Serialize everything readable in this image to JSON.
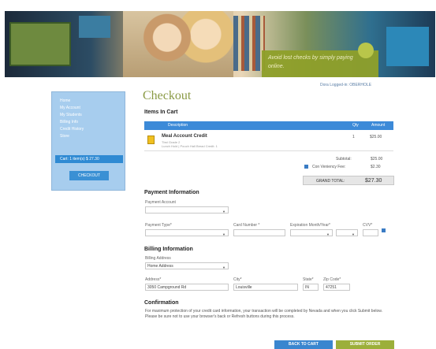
{
  "banner": {
    "tagline": "Avoid lost checks by simply paying online."
  },
  "user": {
    "logged_in": "Dora Logged-in: OBERHOLE"
  },
  "sidebar": {
    "items": [
      {
        "label": "Home"
      },
      {
        "label": "My Account"
      },
      {
        "label": "My Students"
      },
      {
        "label": "Billing Info"
      },
      {
        "label": "Credit History"
      },
      {
        "label": "Store"
      },
      {
        "label": "Cart: 1 item(s) $ 27.30"
      }
    ],
    "checkout_button": "CHECKOUT"
  },
  "page": {
    "title": "Checkout",
    "items_heading": "Items In Cart"
  },
  "cart": {
    "columns": {
      "description": "Description",
      "qty": "Qty",
      "amount": "Amount"
    },
    "items": [
      {
        "name": "Meal Account Credit",
        "sub1": "Tbst Grade 2",
        "sub2": "Lunch Hold | Pouch Hall Bread Credit: 1",
        "qty": "1",
        "amount": "$25.00"
      }
    ],
    "subtotal_label": "Subtotal:",
    "subtotal_value": "$25.00",
    "fee_label": "Con Veniency Fee:",
    "fee_value": "$2.30",
    "grand_total_label": "GRAND TOTAL:",
    "grand_total_value": "$27.30"
  },
  "payment": {
    "heading": "Payment Information",
    "account_label": "Payment Account",
    "card_type_label": "Payment Type*",
    "card_number_label": "Card Number *",
    "expiration_label": "Expiration Month/Year*",
    "cvv_label": "CVV*"
  },
  "billing": {
    "heading": "Billing Information",
    "address_select_label": "Billing Address",
    "address_select_value": "Home Address",
    "address_label": "Address*",
    "address_value": "3050 Campground Rd",
    "city_label": "City*",
    "city_value": "Louisville",
    "state_label": "State*",
    "state_value": "IN",
    "zip_label": "Zip Code*",
    "zip_value": "47251"
  },
  "confirmation": {
    "heading": "Confirmation",
    "text": "For maximum protection of your credit card information, your transaction will be completed by Nevada and when you click Submit below. Please be sure not to use your browser's back or Refresh buttons during this process."
  },
  "buttons": {
    "back": "BACK TO CART",
    "submit": "SUBMIT ORDER"
  },
  "colors": {
    "accent_blue": "#3a86cf",
    "accent_green": "#9caf3a",
    "title_green": "#8a9a45"
  }
}
